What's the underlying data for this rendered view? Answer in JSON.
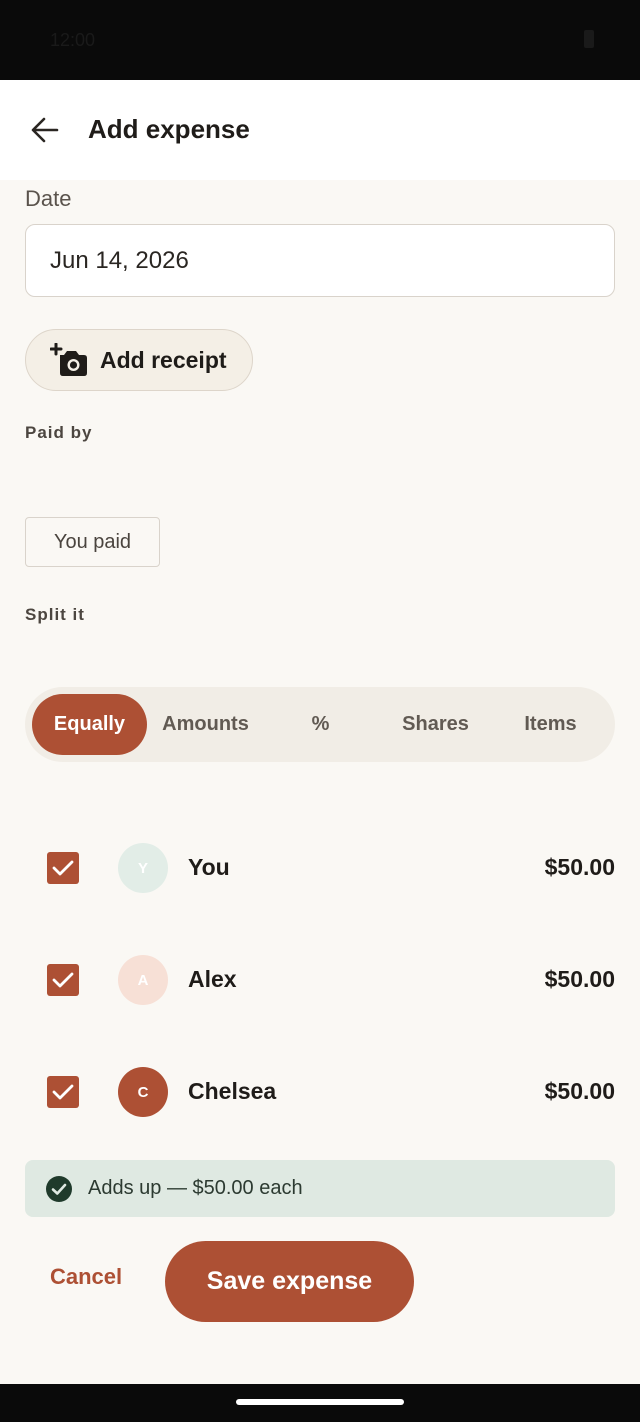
{
  "status_bar": {
    "time": "12:00"
  },
  "app_bar": {
    "title": "Add expense",
    "back_icon": "arrow-left-icon"
  },
  "date": {
    "label": "Date",
    "value": "Jun 14, 2026"
  },
  "receipt": {
    "label": "Add receipt",
    "icon": "add-camera-icon"
  },
  "paid_by": {
    "label": "Paid by",
    "value": "You paid"
  },
  "split": {
    "label": "Split it",
    "tabs": [
      {
        "label": "Equally",
        "active": true
      },
      {
        "label": "Amounts",
        "active": false
      },
      {
        "label": "%",
        "active": false
      },
      {
        "label": "Shares",
        "active": false
      },
      {
        "label": "Items",
        "active": false
      }
    ]
  },
  "people": [
    {
      "initial": "Y",
      "name": "You",
      "amount": "$50.00",
      "checked": true,
      "avatar_bg": "#e2ede7",
      "avatar_fg": "#ffffff"
    },
    {
      "initial": "A",
      "name": "Alex",
      "amount": "$50.00",
      "checked": true,
      "avatar_bg": "#f7e0d6",
      "avatar_fg": "#ffffff"
    },
    {
      "initial": "C",
      "name": "Chelsea",
      "amount": "$50.00",
      "checked": true,
      "avatar_bg": "#ad5034",
      "avatar_fg": "#ffffff"
    }
  ],
  "summary": {
    "text": "Adds up — $50.00 each",
    "icon": "check-circle-icon"
  },
  "actions": {
    "cancel": "Cancel",
    "save": "Save expense"
  },
  "colors": {
    "accent": "#ad5034",
    "success_bg": "#dfe9e2",
    "success_icon": "#1f3a2b"
  }
}
